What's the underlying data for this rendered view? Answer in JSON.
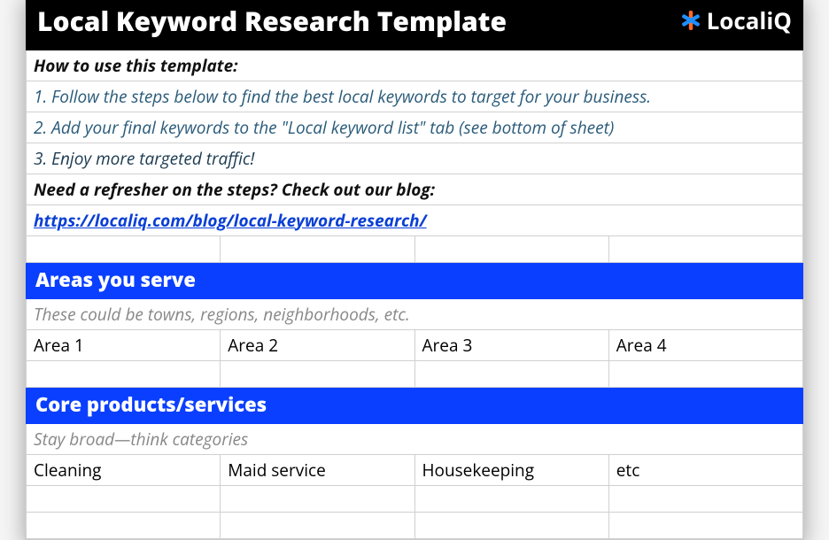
{
  "header": {
    "title": "Local Keyword Research Template",
    "brand": "LocaliQ"
  },
  "instructions": {
    "label": "How to use this template:",
    "steps": [
      "1. Follow the steps below to find the best local keywords to target for your business.",
      "2. Add your final keywords to the \"Local keyword list\" tab (see bottom of sheet)",
      "3. Enjoy more targeted traffic!"
    ]
  },
  "blog": {
    "label": "Need a refresher on the steps? Check out our blog:",
    "url": "https://localiq.com/blog/local-keyword-research/"
  },
  "sections": {
    "areas": {
      "heading": "Areas you serve",
      "description": "These could be towns, regions, neighborhoods, etc.",
      "row1": {
        "c1": "Area 1",
        "c2": "Area 2",
        "c3": "Area 3",
        "c4": "Area 4"
      }
    },
    "services": {
      "heading": "Core products/services",
      "description": "Stay broad—think categories",
      "row1": {
        "c1": "Cleaning",
        "c2": "Maid service",
        "c3": "Housekeeping",
        "c4": "etc"
      }
    }
  }
}
